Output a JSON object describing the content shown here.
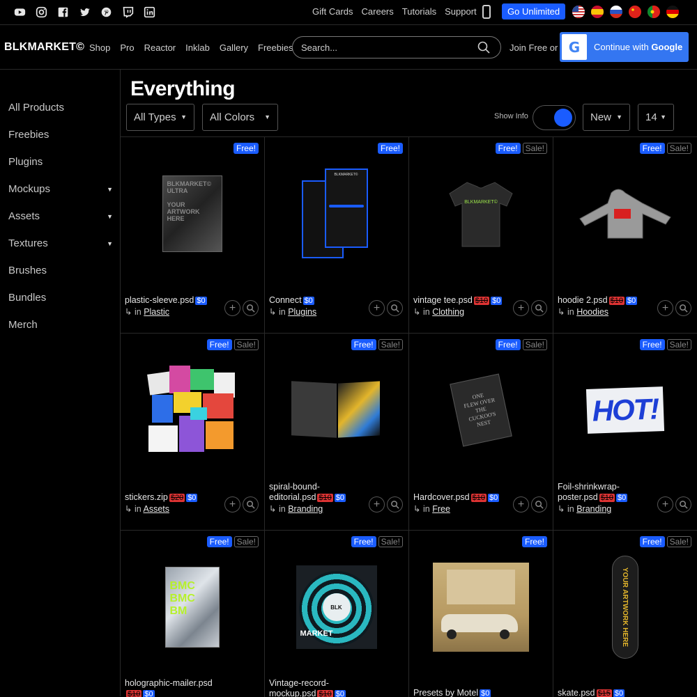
{
  "social": [
    "youtube-icon",
    "instagram-icon",
    "facebook-icon",
    "twitter-icon",
    "pinterest-icon",
    "twitch-icon",
    "linkedin-icon"
  ],
  "topbar": {
    "links": [
      "Gift Cards",
      "Careers",
      "Tutorials",
      "Support"
    ],
    "cta": "Go Unlimited",
    "flags": [
      "us-flag",
      "es-flag",
      "ru-flag",
      "cn-flag",
      "pt-flag",
      "de-flag"
    ]
  },
  "nav": {
    "logo": "BLKMARKET©",
    "links": [
      "Shop",
      "Pro",
      "Reactor",
      "Inklab",
      "Gallery",
      "Freebies"
    ],
    "search_placeholder": "Search...",
    "join": "Join Free or",
    "google_prefix": "Continue with",
    "google_brand": "Google",
    "google_letter": "G"
  },
  "sidebar": [
    {
      "label": "All Products",
      "caret": false
    },
    {
      "label": "Freebies",
      "caret": false
    },
    {
      "label": "Plugins",
      "caret": false
    },
    {
      "label": "Mockups",
      "caret": true
    },
    {
      "label": "Assets",
      "caret": true
    },
    {
      "label": "Textures",
      "caret": true
    },
    {
      "label": "Brushes",
      "caret": false
    },
    {
      "label": "Bundles",
      "caret": false
    },
    {
      "label": "Merch",
      "caret": false
    }
  ],
  "header": {
    "title": "Everything",
    "type_filter": "All Types",
    "color_filter": "All Colors",
    "show_info": "Show Info",
    "show_info_on": true,
    "sort": "New",
    "per_page": "14"
  },
  "labels": {
    "free": "Free!",
    "sale": "Sale!",
    "in": "in",
    "cat_arrow": "↳"
  },
  "products": [
    {
      "name": "plastic-sleeve.psd",
      "old_price": "",
      "price": "$0",
      "category": "Plastic",
      "sale": false
    },
    {
      "name": "Connect",
      "old_price": "",
      "price": "$0",
      "category": "Plugins",
      "sale": false
    },
    {
      "name": "vintage tee.psd",
      "old_price": "$10",
      "price": "$0",
      "category": "Clothing",
      "sale": true
    },
    {
      "name": "hoodie 2.psd",
      "old_price": "$10",
      "price": "$0",
      "category": "Hoodies",
      "sale": true
    },
    {
      "name": "stickers.zip",
      "old_price": "$20",
      "price": "$0",
      "category": "Assets",
      "sale": true
    },
    {
      "name": "spiral-bound-editorial.psd",
      "old_price": "$10",
      "price": "$0",
      "category": "Branding",
      "sale": true
    },
    {
      "name": "Hardcover.psd",
      "old_price": "$10",
      "price": "$0",
      "category": "Free",
      "sale": true
    },
    {
      "name": "Foil-shrinkwrap-poster.psd",
      "old_price": "$10",
      "price": "$0",
      "category": "Branding",
      "sale": true
    },
    {
      "name": "holographic-mailer.psd",
      "old_price": "$10",
      "price": "$0",
      "category": "",
      "sale": true
    },
    {
      "name": "Vintage-record-mockup.psd",
      "old_price": "$10",
      "price": "$0",
      "category": "",
      "sale": true
    },
    {
      "name": "Presets by Motel",
      "old_price": "",
      "price": "$0",
      "category": "",
      "sale": false
    },
    {
      "name": "skate.psd",
      "old_price": "$15",
      "price": "$0",
      "category": "",
      "sale": true
    }
  ],
  "thumb_text": {
    "sleeve": [
      "BLKMARKET©",
      "ULTRA",
      "YOUR",
      "ARTWORK",
      "HERE"
    ],
    "connect_title": "BLKMARKET©",
    "tee": "BLKMARKET©",
    "hot": "HOT!",
    "book": [
      "ONE",
      "FLEW OVER",
      "THE",
      "CUCKOO'S",
      "NEST"
    ],
    "mailer": [
      "BMC",
      "BMC",
      "BM"
    ],
    "record": [
      "BLK",
      "MARKET"
    ],
    "skate": "YOUR ARTWORK HERE"
  }
}
